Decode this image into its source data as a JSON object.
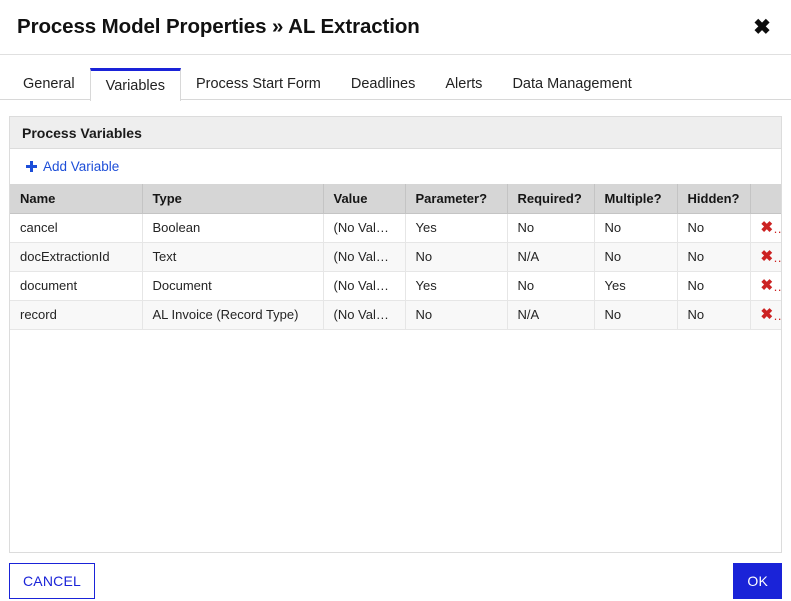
{
  "dialog": {
    "title": "Process Model Properties » AL Extraction",
    "close_icon": "close-icon",
    "close_glyph": "✖"
  },
  "tabs": [
    {
      "label": "General",
      "active": false
    },
    {
      "label": "Variables",
      "active": true
    },
    {
      "label": "Process Start Form",
      "active": false
    },
    {
      "label": "Deadlines",
      "active": false
    },
    {
      "label": "Alerts",
      "active": false
    },
    {
      "label": "Data Management",
      "active": false
    }
  ],
  "panel": {
    "header": "Process Variables",
    "add_variable_label": "Add Variable",
    "add_variable_icon": "plus-icon"
  },
  "table": {
    "columns": [
      "Name",
      "Type",
      "Value",
      "Parameter?",
      "Required?",
      "Multiple?",
      "Hidden?",
      ""
    ],
    "rows": [
      {
        "name": "cancel",
        "type": "Boolean",
        "value": "(No Value)",
        "parameter": "Yes",
        "required": "No",
        "multiple": "No",
        "hidden": "No",
        "delete_glyph": "✖"
      },
      {
        "name": "docExtractionId",
        "type": "Text",
        "value": "(No Value)",
        "parameter": "No",
        "required": "N/A",
        "multiple": "No",
        "hidden": "No",
        "delete_glyph": "✖"
      },
      {
        "name": "document",
        "type": "Document",
        "value": "(No Value)",
        "parameter": "Yes",
        "required": "No",
        "multiple": "Yes",
        "hidden": "No",
        "delete_glyph": "✖"
      },
      {
        "name": "record",
        "type": "AL Invoice (Record Type)",
        "value": "(No Value)",
        "parameter": "No",
        "required": "N/A",
        "multiple": "No",
        "hidden": "No",
        "delete_glyph": "✖"
      }
    ]
  },
  "footer": {
    "cancel_label": "CANCEL",
    "ok_label": "OK"
  },
  "colors": {
    "accent_blue": "#1a23d8",
    "link_blue": "#1d4ed8",
    "delete_red": "#cc2222",
    "header_gray": "#d6d6d6",
    "panel_header_gray": "#eeeeee"
  }
}
